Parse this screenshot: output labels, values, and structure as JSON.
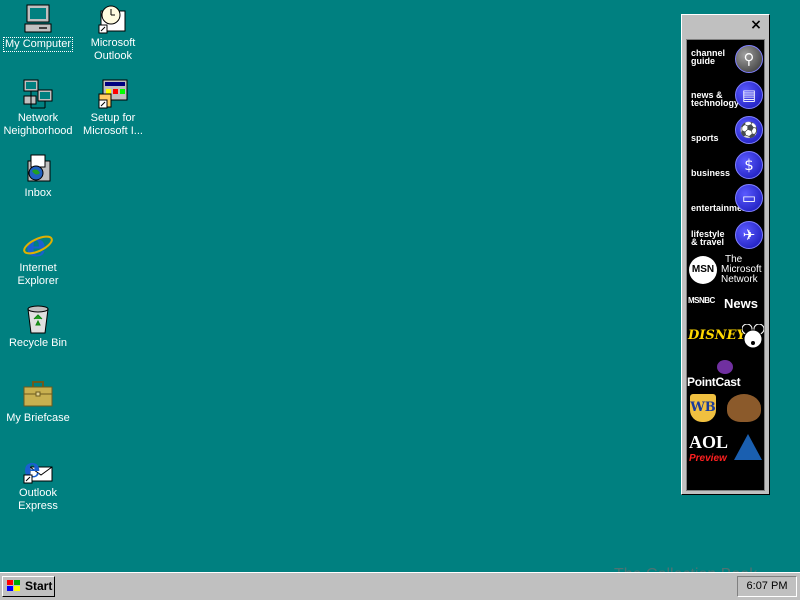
{
  "desktop": {
    "icons": [
      {
        "label": "My Computer",
        "icon": "my-computer-icon"
      },
      {
        "label": "Microsoft Outlook",
        "icon": "outlook-icon"
      },
      {
        "label": "Network Neighborhood",
        "icon": "network-icon"
      },
      {
        "label": "Setup for Microsoft I...",
        "icon": "setup-icon"
      },
      {
        "label": "Inbox",
        "icon": "inbox-icon"
      },
      {
        "label": "Internet Explorer",
        "icon": "ie-icon"
      },
      {
        "label": "Recycle Bin",
        "icon": "recycle-bin-icon"
      },
      {
        "label": "My Briefcase",
        "icon": "briefcase-icon"
      },
      {
        "label": "Outlook Express",
        "icon": "outlook-express-icon"
      }
    ]
  },
  "channel_bar": {
    "close_glyph": "×",
    "channels": [
      {
        "label_1": "channel",
        "label_2": "guide",
        "icon": "magnifier-icon"
      },
      {
        "label_1": "news &",
        "label_2": "technology",
        "icon": "newspaper-icon"
      },
      {
        "label_1": "sports",
        "label_2": "",
        "icon": "ball-icon"
      },
      {
        "label_1": "business",
        "label_2": "",
        "icon": "dollar-icon"
      },
      {
        "label_1": "entertainment",
        "label_2": "",
        "icon": "tv-icon"
      },
      {
        "label_1": "lifestyle",
        "label_2": "& travel",
        "icon": "airplane-icon"
      }
    ],
    "brands": {
      "msn_logo": "MSN",
      "msn_line1": "The",
      "msn_line2": "Microsoft",
      "msn_line3": "Network",
      "msnbc_logo": "MSNBC",
      "msnbc_news": "News",
      "disney": "DISNEY",
      "pointcast": "PointCast",
      "warner": "WB",
      "aol": "AOL",
      "aol_sub": "Preview"
    }
  },
  "taskbar": {
    "start_label": "Start",
    "clock": "6:07 PM"
  },
  "watermark": "The Collection Book"
}
